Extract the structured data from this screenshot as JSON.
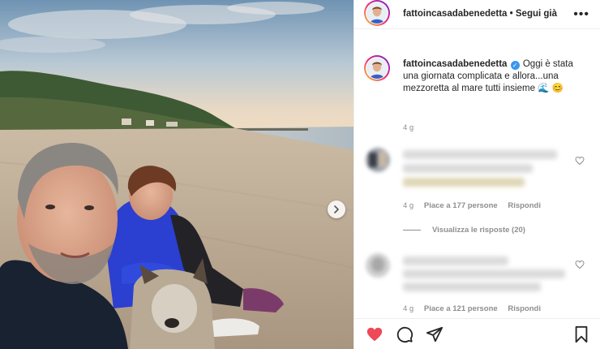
{
  "post": {
    "username": "fattoincasadabenedetta",
    "follow_label": "Segui già",
    "header_separator": "•",
    "more_label": "•••",
    "caption_text": "Oggi è stata una giornata complicata e allora...una mezzoretta al mare tutti insieme",
    "caption_emojis": "🌊 😊",
    "caption_time": "4 g"
  },
  "comments": [
    {
      "time": "4 g",
      "likes": "Piace a 177 persone",
      "reply_label": "Rispondi",
      "view_replies": "Visualizza le risposte (20)"
    },
    {
      "time": "4 g",
      "likes": "Piace a 121 persone",
      "reply_label": "Rispondi"
    }
  ],
  "icons": {
    "like": "heart-icon",
    "comment": "comment-icon",
    "share": "share-icon",
    "save": "bookmark-icon",
    "next": "chevron-right-icon",
    "more": "more-icon",
    "verified": "verified-badge-icon"
  },
  "colors": {
    "liked": "#ed4956",
    "verified": "#3897f0",
    "text": "#262626",
    "muted": "#8e8e8e"
  }
}
